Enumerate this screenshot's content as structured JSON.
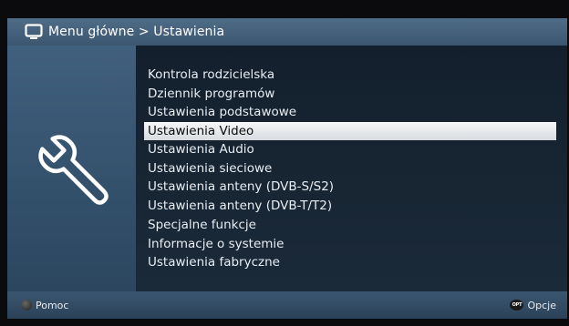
{
  "header": {
    "icon": "tv-icon",
    "breadcrumb": "Menu główne > Ustawienia"
  },
  "sidebar": {
    "icon": "wrench-icon"
  },
  "menu": {
    "selected_index": 3,
    "items": [
      {
        "label": "Kontrola rodzicielska"
      },
      {
        "label": "Dziennik programów"
      },
      {
        "label": "Ustawienia podstawowe"
      },
      {
        "label": "Ustawienia Video"
      },
      {
        "label": "Ustawienia Audio"
      },
      {
        "label": "Ustawienia sieciowe"
      },
      {
        "label": "Ustawienia anteny (DVB-S/S2)"
      },
      {
        "label": "Ustawienia anteny (DVB-T/T2)"
      },
      {
        "label": "Specjalne funkcje"
      },
      {
        "label": "Informacje o systemie"
      },
      {
        "label": "Ustawienia fabryczne"
      }
    ]
  },
  "footer": {
    "help_label": "Pomoc",
    "options_label": "Opcje",
    "options_key": "OPT"
  },
  "colors": {
    "header_bar": "#4a6682",
    "menu_background": "#162330",
    "selection": "#eef0f2"
  }
}
